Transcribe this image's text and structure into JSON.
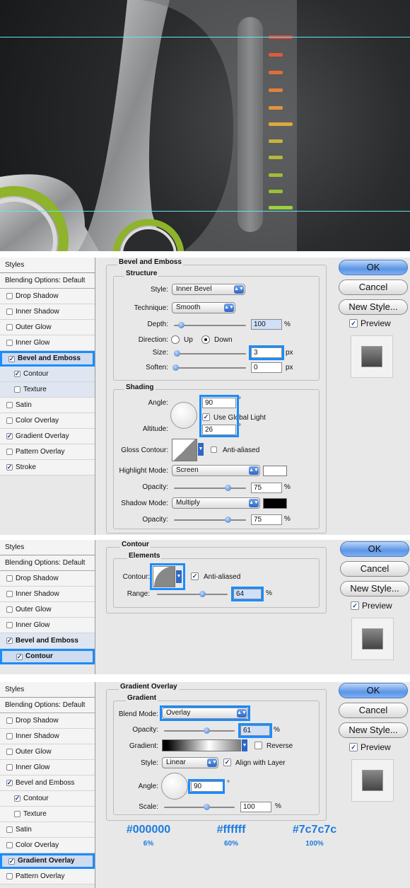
{
  "sidebar": {
    "header": "Styles",
    "blending": "Blending Options: Default",
    "items": [
      "Drop Shadow",
      "Inner Shadow",
      "Outer Glow",
      "Inner Glow",
      "Bevel and Emboss",
      "Contour",
      "Texture",
      "Satin",
      "Color Overlay",
      "Gradient Overlay",
      "Pattern Overlay",
      "Stroke"
    ]
  },
  "buttons": {
    "ok": "OK",
    "cancel": "Cancel",
    "new_style": "New Style...",
    "preview": "Preview"
  },
  "bevel": {
    "section_title": "Bevel and Emboss",
    "structure_title": "Structure",
    "style_label": "Style:",
    "style_value": "Inner Bevel",
    "technique_label": "Technique:",
    "technique_value": "Smooth",
    "depth_label": "Depth:",
    "depth_value": "100",
    "direction_label": "Direction:",
    "dir_up": "Up",
    "dir_down": "Down",
    "size_label": "Size:",
    "size_value": "3",
    "soften_label": "Soften:",
    "soften_value": "0",
    "unit_px": "px",
    "unit_pct": "%",
    "shading_title": "Shading",
    "angle_label": "Angle:",
    "angle_value": "90",
    "global_light": "Use Global Light",
    "altitude_label": "Altitude:",
    "altitude_value": "26",
    "deg": "°",
    "gloss_label": "Gloss Contour:",
    "anti_aliased": "Anti-aliased",
    "highlight_label": "Highlight Mode:",
    "highlight_value": "Screen",
    "opacity_label": "Opacity:",
    "highlight_opacity": "75",
    "shadow_label": "Shadow Mode:",
    "shadow_value": "Multiply",
    "shadow_opacity": "75"
  },
  "contour": {
    "section_title": "Contour",
    "elements_title": "Elements",
    "contour_label": "Contour:",
    "anti_aliased": "Anti-aliased",
    "range_label": "Range:",
    "range_value": "64",
    "unit_pct": "%"
  },
  "gradient": {
    "section_title": "Gradient Overlay",
    "group_title": "Gradient",
    "blend_label": "Blend Mode:",
    "blend_value": "Overlay",
    "opacity_label": "Opacity:",
    "opacity_value": "61",
    "gradient_label": "Gradient:",
    "reverse": "Reverse",
    "style_label": "Style:",
    "style_value": "Linear",
    "align": "Align with Layer",
    "angle_label": "Angle:",
    "angle_value": "90",
    "scale_label": "Scale:",
    "scale_value": "100",
    "unit_pct": "%",
    "deg": "°"
  },
  "color_stops": [
    {
      "hex": "#000000",
      "pos": "6%"
    },
    {
      "hex": "#ffffff",
      "pos": "60%"
    },
    {
      "hex": "#7c7c7c",
      "pos": "100%"
    }
  ],
  "colors": {
    "accent": "#1a8cff",
    "guide": "#5fe6ee",
    "lime": "#8fb32a"
  }
}
